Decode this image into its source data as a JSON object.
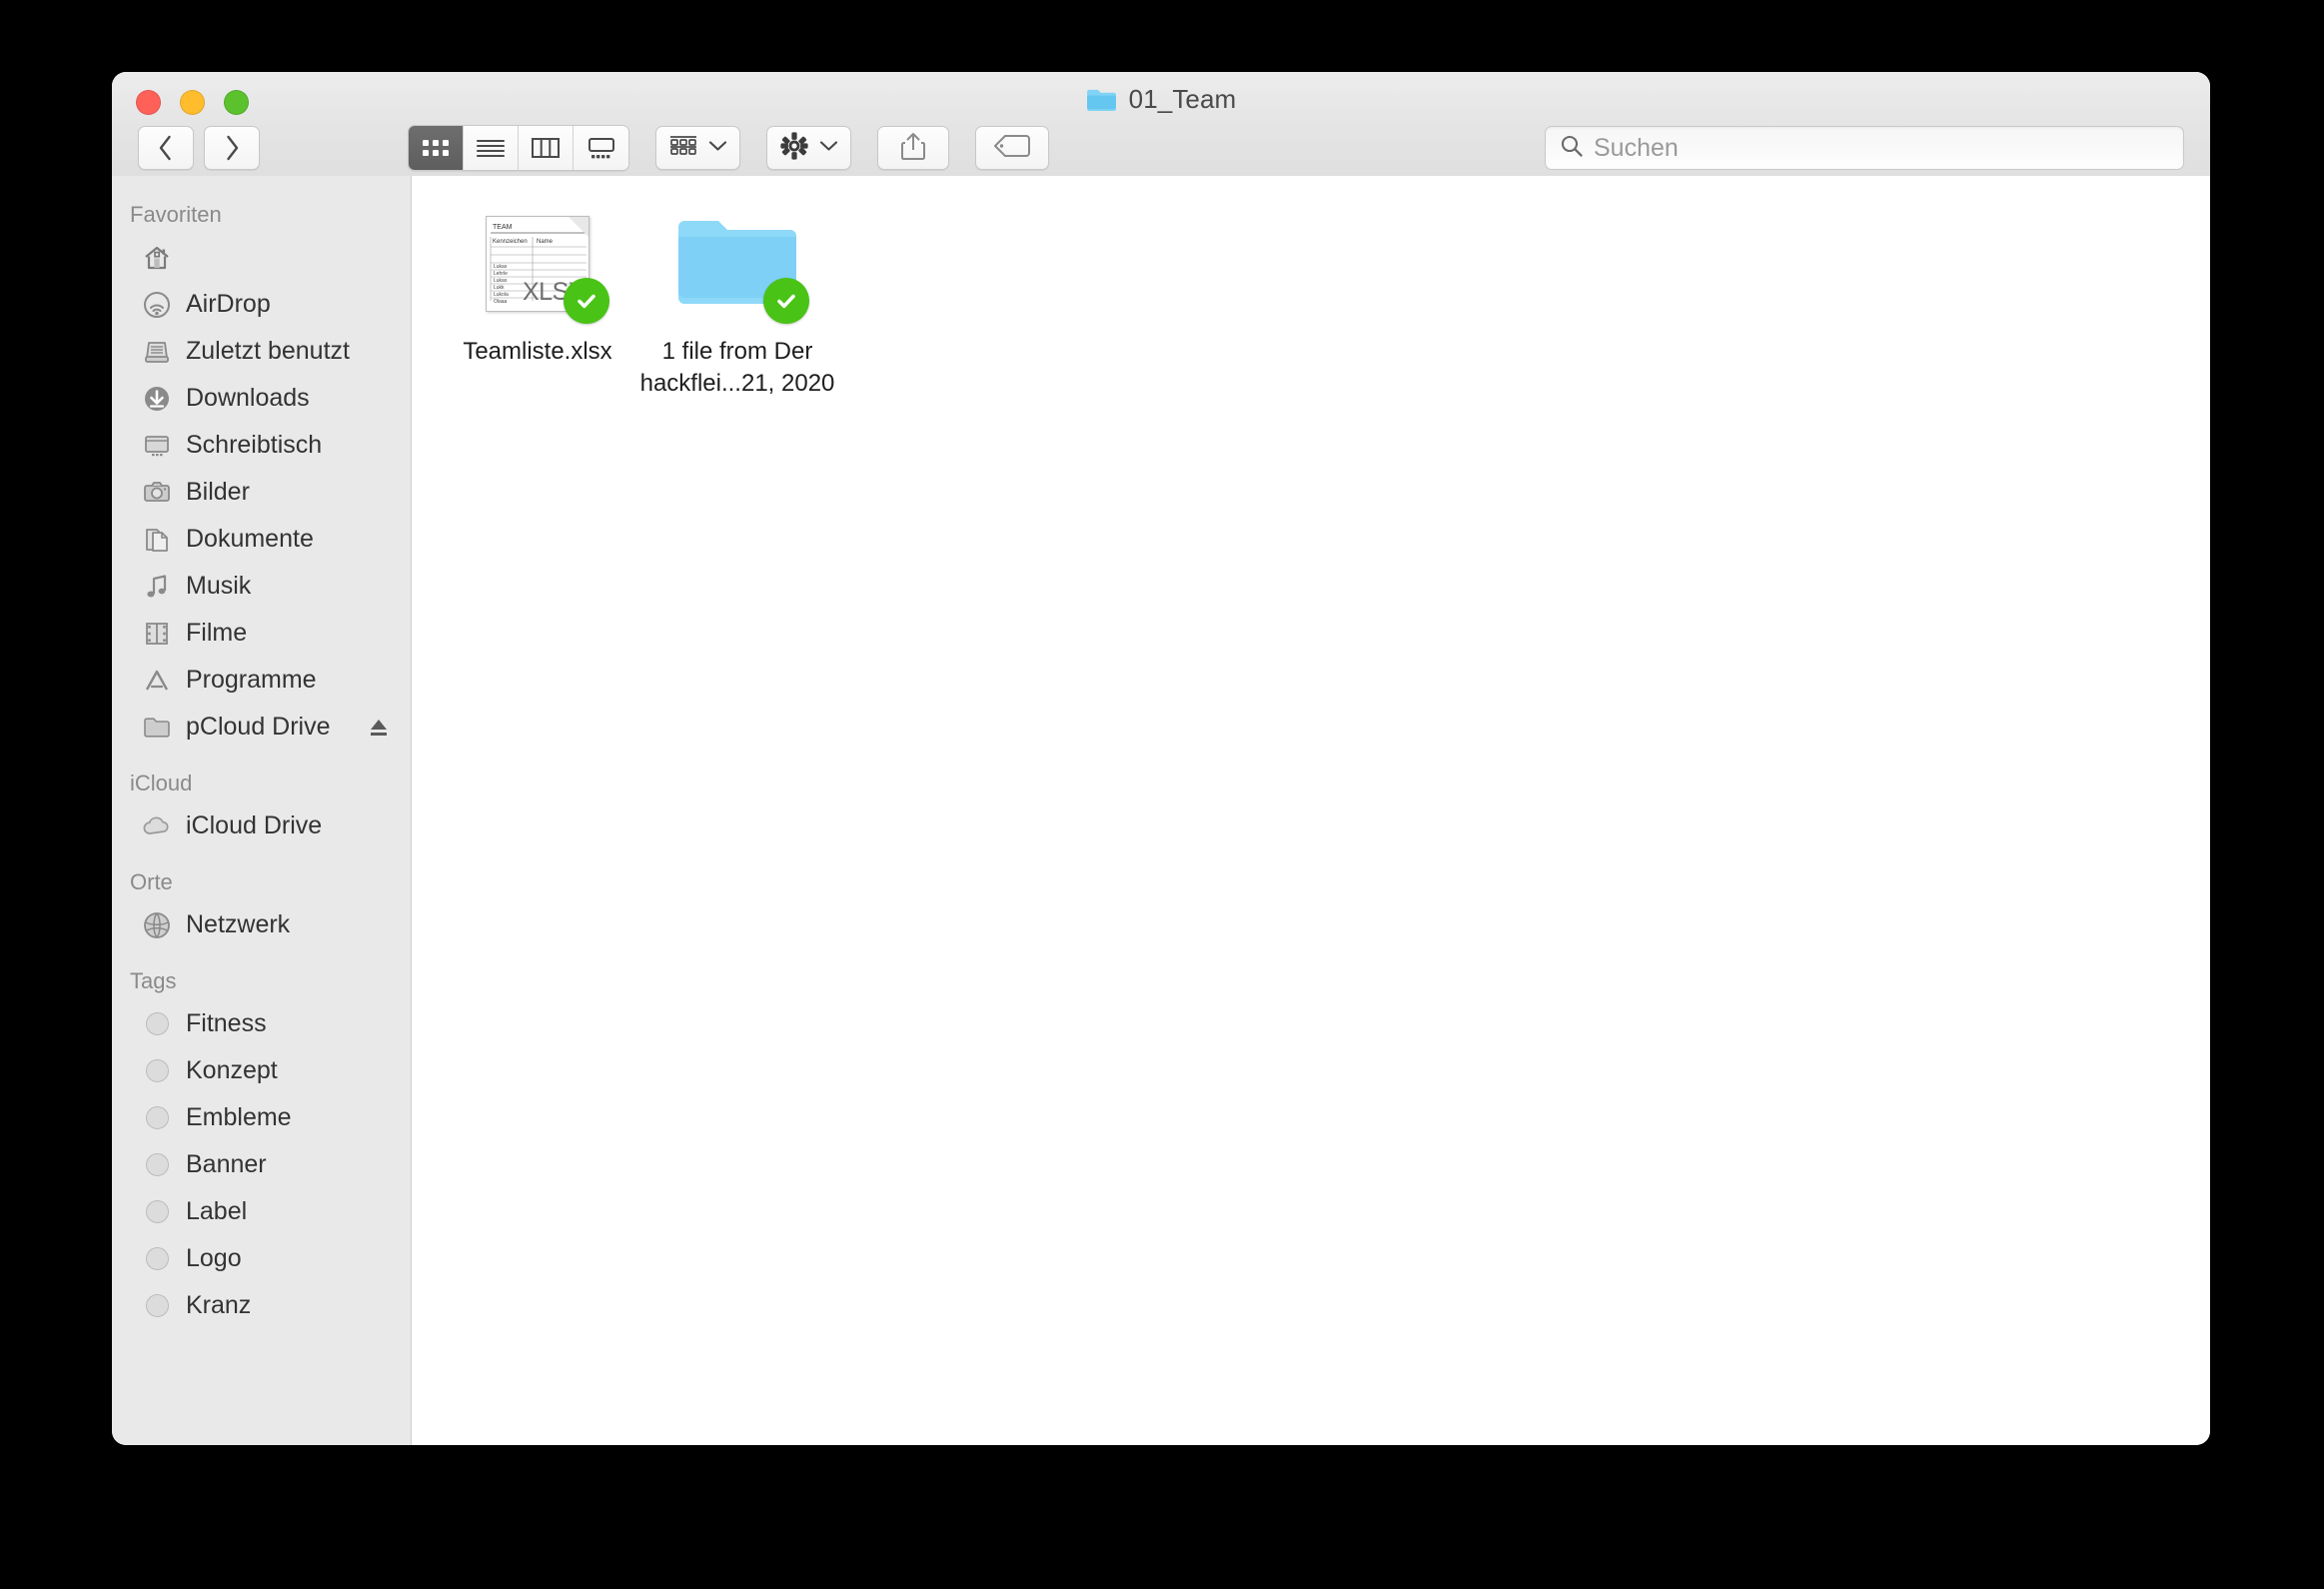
{
  "window": {
    "title": "01_Team",
    "title_icon": "folder-icon",
    "traffic_lights": [
      {
        "name": "close-button",
        "color": "#ff6159"
      },
      {
        "name": "minimize-button",
        "color": "#ffbd2e"
      },
      {
        "name": "maximize-button",
        "color": "#5bc22e"
      }
    ]
  },
  "toolbar": {
    "back_label": "‹",
    "forward_label": "›",
    "views": [
      {
        "name": "icon-view",
        "label": "Symbolansicht",
        "active": true
      },
      {
        "name": "list-view",
        "label": "Listenansicht",
        "active": false
      },
      {
        "name": "column-view",
        "label": "Spaltenansicht",
        "active": false
      },
      {
        "name": "gallery-view",
        "label": "Galerieansicht",
        "active": false
      }
    ],
    "arrange_label": "Anordnen nach",
    "action_label": "Aktion",
    "share_label": "Teilen",
    "tags_label": "Tags bearbeiten"
  },
  "search": {
    "placeholder": "Suchen",
    "value": ""
  },
  "sidebar": {
    "sections": [
      {
        "header": "Favoriten",
        "items": [
          {
            "label": "",
            "icon": "home-icon"
          },
          {
            "label": "AirDrop",
            "icon": "airdrop-icon"
          },
          {
            "label": "Zuletzt benutzt",
            "icon": "recents-icon"
          },
          {
            "label": "Downloads",
            "icon": "downloads-icon"
          },
          {
            "label": "Schreibtisch",
            "icon": "desktop-icon"
          },
          {
            "label": "Bilder",
            "icon": "pictures-icon"
          },
          {
            "label": "Dokumente",
            "icon": "documents-icon"
          },
          {
            "label": "Musik",
            "icon": "music-icon"
          },
          {
            "label": "Filme",
            "icon": "movies-icon"
          },
          {
            "label": "Programme",
            "icon": "applications-icon"
          },
          {
            "label": "pCloud Drive",
            "icon": "folder-icon",
            "eject": true
          }
        ]
      },
      {
        "header": "iCloud",
        "items": [
          {
            "label": "iCloud Drive",
            "icon": "cloud-icon"
          }
        ]
      },
      {
        "header": "Orte",
        "items": [
          {
            "label": "Netzwerk",
            "icon": "network-globe-icon"
          }
        ]
      },
      {
        "header": "Tags",
        "items": [
          {
            "label": "Fitness",
            "icon": "tag-dot-icon"
          },
          {
            "label": "Konzept",
            "icon": "tag-dot-icon"
          },
          {
            "label": "Embleme",
            "icon": "tag-dot-icon"
          },
          {
            "label": "Banner",
            "icon": "tag-dot-icon"
          },
          {
            "label": "Label",
            "icon": "tag-dot-icon"
          },
          {
            "label": "Logo",
            "icon": "tag-dot-icon"
          },
          {
            "label": "Kranz",
            "icon": "tag-dot-icon"
          }
        ]
      }
    ]
  },
  "content": {
    "items": [
      {
        "name": "Teamliste.xlsx",
        "kind": "xlsx-file",
        "badge": "synced-check",
        "thumbnail": {
          "title": "TEAM",
          "columns": [
            "Kennzeichen",
            "Name"
          ],
          "format_label": "XLSX"
        }
      },
      {
        "name": "1 file from Der hackflei...21, 2020",
        "kind": "folder",
        "badge": "synced-check"
      }
    ]
  },
  "colors": {
    "folder_blue": "#7fd3f4",
    "folder_blue_dark": "#63c7f0",
    "badge_green": "#49c316",
    "sidebar_bg": "#e9e9e9",
    "titlebar_bg": "#e6e6e6"
  }
}
